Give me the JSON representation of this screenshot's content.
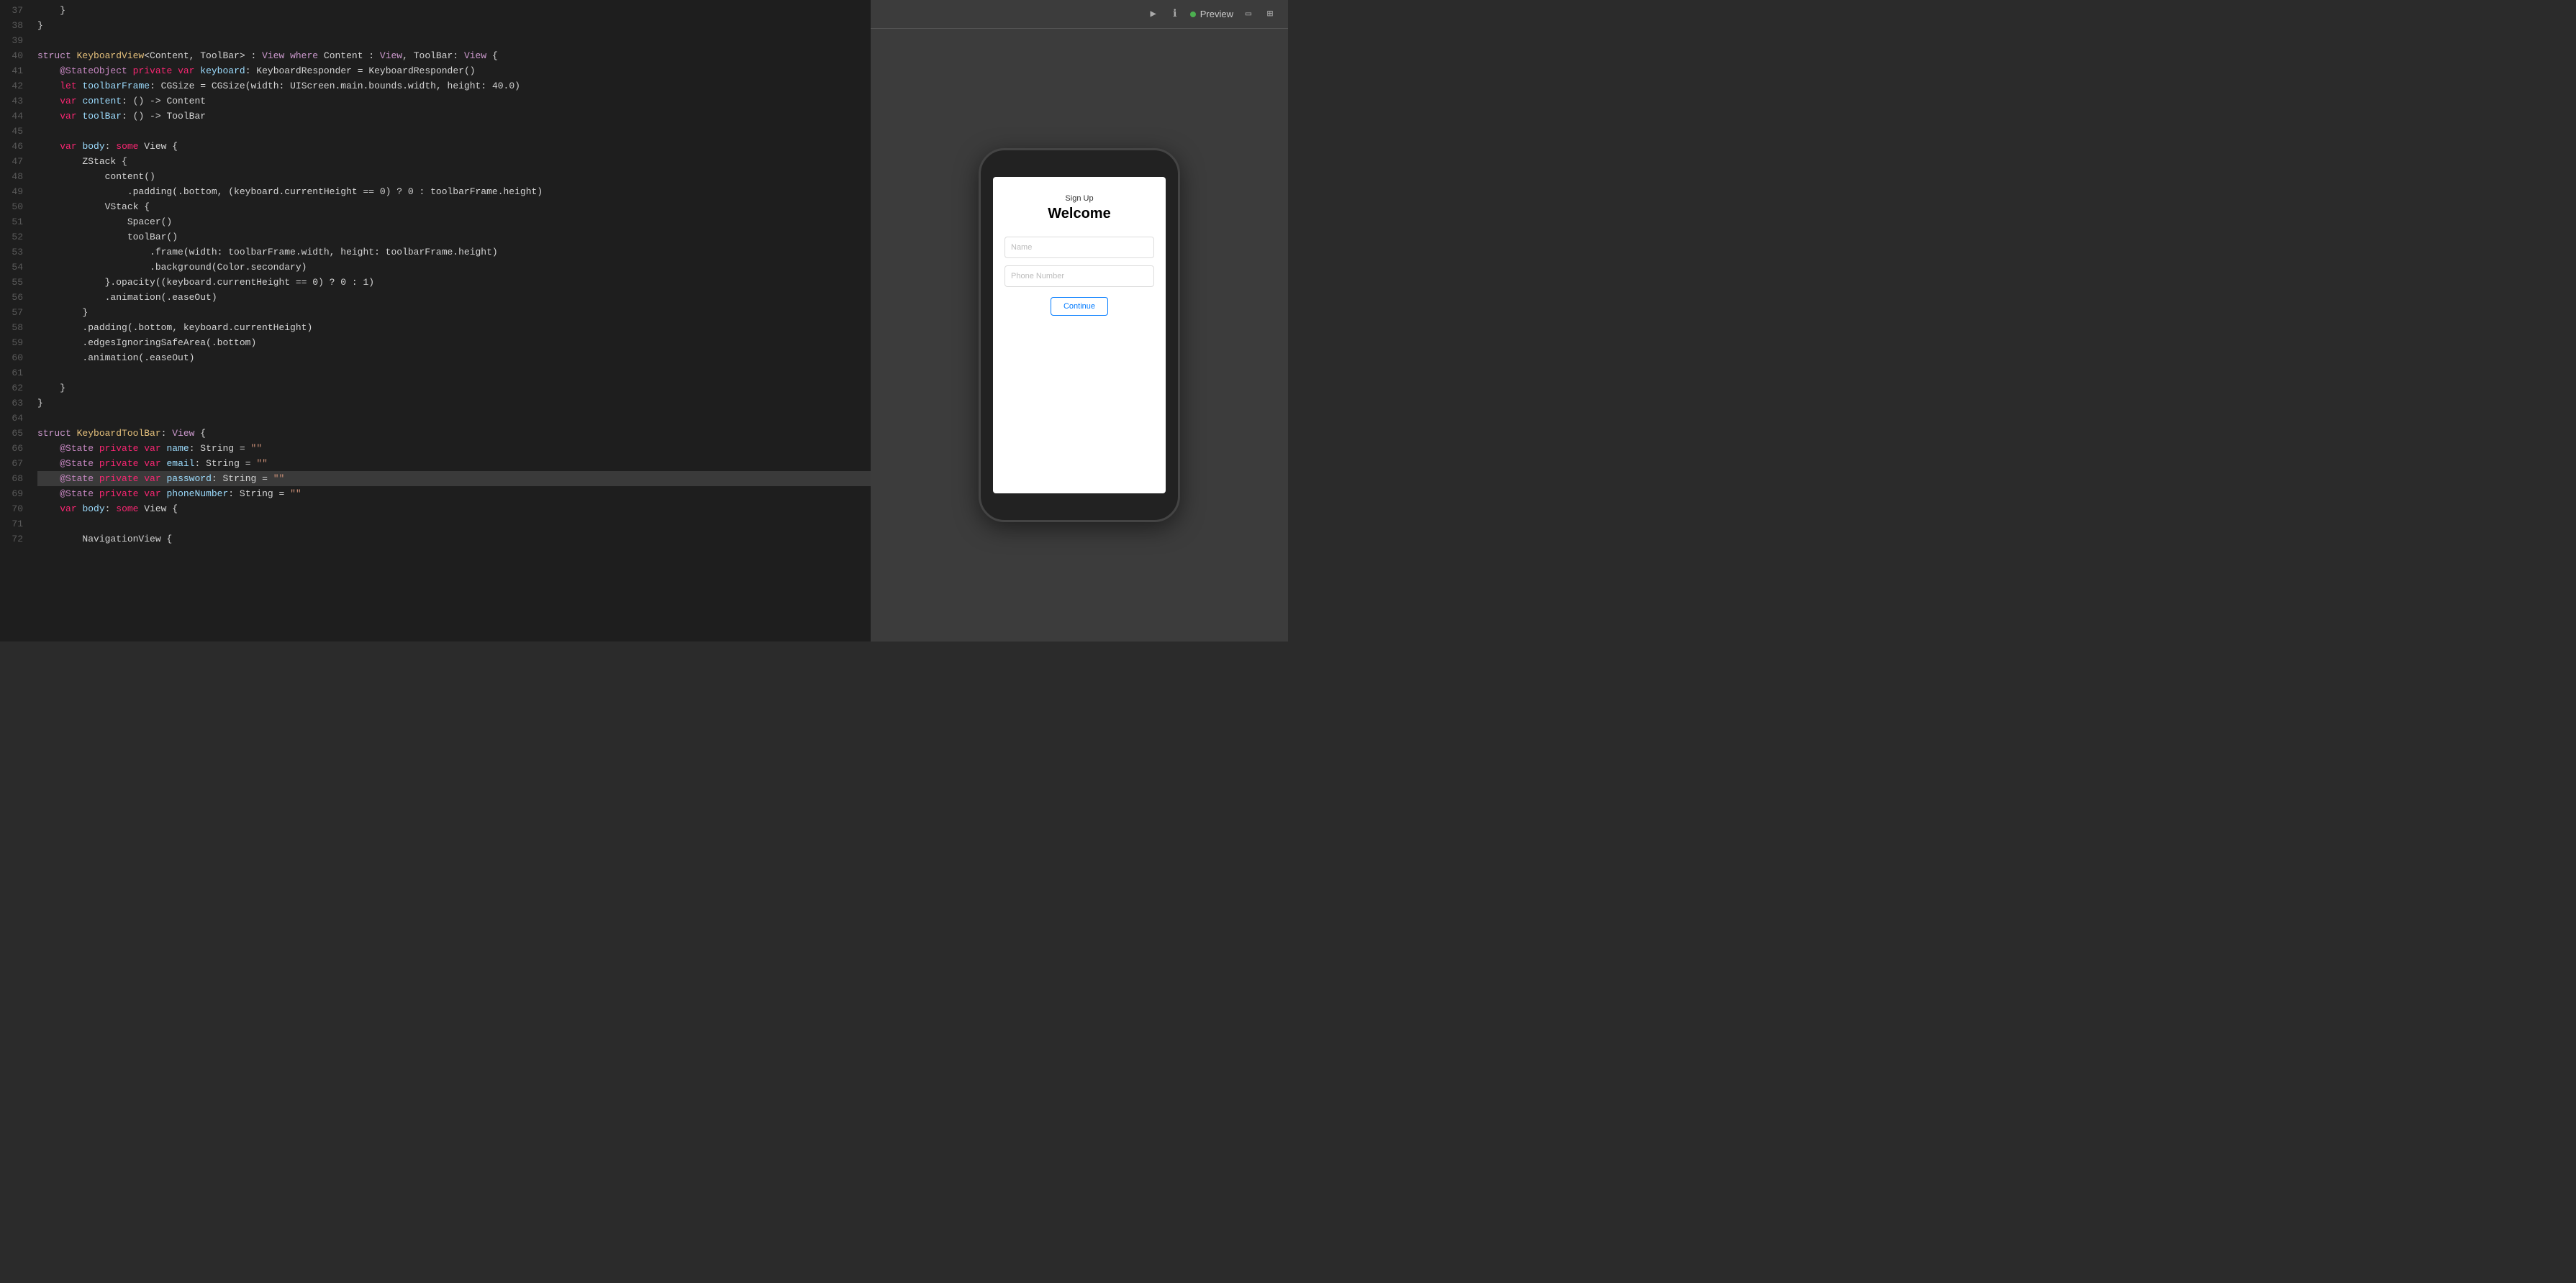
{
  "editor": {
    "lines": [
      {
        "num": 37,
        "content": [
          {
            "text": "    }",
            "class": "plain"
          }
        ],
        "highlighted": false
      },
      {
        "num": 38,
        "content": [
          {
            "text": "}",
            "class": "plain"
          }
        ],
        "highlighted": false
      },
      {
        "num": 39,
        "content": [],
        "highlighted": false
      },
      {
        "num": 40,
        "content": [
          {
            "text": "struct ",
            "class": "kw-struct"
          },
          {
            "text": "KeyboardView",
            "class": "type-name"
          },
          {
            "text": "<Content, ToolBar> : ",
            "class": "plain"
          },
          {
            "text": "View ",
            "class": "kw-view"
          },
          {
            "text": "where ",
            "class": "kw-where"
          },
          {
            "text": "Content : ",
            "class": "plain"
          },
          {
            "text": "View",
            "class": "kw-view"
          },
          {
            "text": ", ToolBar: ",
            "class": "plain"
          },
          {
            "text": "View",
            "class": "kw-view"
          },
          {
            "text": " {",
            "class": "plain"
          }
        ],
        "highlighted": false
      },
      {
        "num": 41,
        "content": [
          {
            "text": "    ",
            "class": "plain"
          },
          {
            "text": "@StateObject ",
            "class": "state-decorator"
          },
          {
            "text": "private ",
            "class": "pink-kw"
          },
          {
            "text": "var ",
            "class": "pink-kw"
          },
          {
            "text": "keyboard",
            "class": "blue-prop"
          },
          {
            "text": ": KeyboardResponder = KeyboardResponder()",
            "class": "plain"
          }
        ],
        "highlighted": false
      },
      {
        "num": 42,
        "content": [
          {
            "text": "    ",
            "class": "plain"
          },
          {
            "text": "let ",
            "class": "pink-kw"
          },
          {
            "text": "toolbarFrame",
            "class": "blue-prop"
          },
          {
            "text": ": CGSize = CGSize(width: UIScreen.main.bounds.width, height: 40.0)",
            "class": "plain"
          }
        ],
        "highlighted": false
      },
      {
        "num": 43,
        "content": [
          {
            "text": "    ",
            "class": "plain"
          },
          {
            "text": "var ",
            "class": "pink-kw"
          },
          {
            "text": "content",
            "class": "blue-prop"
          },
          {
            "text": ": () -> Content",
            "class": "plain"
          }
        ],
        "highlighted": false
      },
      {
        "num": 44,
        "content": [
          {
            "text": "    ",
            "class": "plain"
          },
          {
            "text": "var ",
            "class": "pink-kw"
          },
          {
            "text": "toolBar",
            "class": "blue-prop"
          },
          {
            "text": ": () -> ToolBar",
            "class": "plain"
          }
        ],
        "highlighted": false
      },
      {
        "num": 45,
        "content": [],
        "highlighted": false
      },
      {
        "num": 46,
        "content": [
          {
            "text": "    ",
            "class": "plain"
          },
          {
            "text": "var ",
            "class": "pink-kw"
          },
          {
            "text": "body",
            "class": "blue-prop"
          },
          {
            "text": ": ",
            "class": "plain"
          },
          {
            "text": "some ",
            "class": "pink-kw"
          },
          {
            "text": "View",
            "class": "plain"
          },
          {
            "text": " {",
            "class": "plain"
          }
        ],
        "highlighted": false
      },
      {
        "num": 47,
        "content": [
          {
            "text": "        ZStack {",
            "class": "plain"
          }
        ],
        "highlighted": false
      },
      {
        "num": 48,
        "content": [
          {
            "text": "            content()",
            "class": "plain"
          }
        ],
        "highlighted": false
      },
      {
        "num": 49,
        "content": [
          {
            "text": "                .padding(.bottom, (keyboard.currentHeight == 0) ? 0 : toolbarFrame.height)",
            "class": "plain"
          }
        ],
        "highlighted": false
      },
      {
        "num": 50,
        "content": [
          {
            "text": "            VStack {",
            "class": "plain"
          }
        ],
        "highlighted": false
      },
      {
        "num": 51,
        "content": [
          {
            "text": "                Spacer()",
            "class": "plain"
          }
        ],
        "highlighted": false
      },
      {
        "num": 52,
        "content": [
          {
            "text": "                toolBar()",
            "class": "plain"
          }
        ],
        "highlighted": false
      },
      {
        "num": 53,
        "content": [
          {
            "text": "                    .frame(width: toolbarFrame.width, height: toolbarFrame.height)",
            "class": "plain"
          }
        ],
        "highlighted": false
      },
      {
        "num": 54,
        "content": [
          {
            "text": "                    .background(Color.secondary)",
            "class": "plain"
          }
        ],
        "highlighted": false
      },
      {
        "num": 55,
        "content": [
          {
            "text": "            }.opacity((keyboard.currentHeight == 0) ? 0 : 1)",
            "class": "plain"
          }
        ],
        "highlighted": false
      },
      {
        "num": 56,
        "content": [
          {
            "text": "            .animation(.easeOut)",
            "class": "plain"
          }
        ],
        "highlighted": false
      },
      {
        "num": 57,
        "content": [
          {
            "text": "        }",
            "class": "plain"
          }
        ],
        "highlighted": false
      },
      {
        "num": 58,
        "content": [
          {
            "text": "        .padding(.bottom, keyboard.currentHeight)",
            "class": "plain"
          }
        ],
        "highlighted": false
      },
      {
        "num": 59,
        "content": [
          {
            "text": "        .edgesIgnoringSafeArea(.bottom)",
            "class": "plain"
          }
        ],
        "highlighted": false
      },
      {
        "num": 60,
        "content": [
          {
            "text": "        .animation(.easeOut)",
            "class": "plain"
          }
        ],
        "highlighted": false
      },
      {
        "num": 61,
        "content": [],
        "highlighted": false
      },
      {
        "num": 62,
        "content": [
          {
            "text": "    }",
            "class": "plain"
          }
        ],
        "highlighted": false
      },
      {
        "num": 63,
        "content": [
          {
            "text": "}",
            "class": "plain"
          }
        ],
        "highlighted": false
      },
      {
        "num": 64,
        "content": [],
        "highlighted": false
      },
      {
        "num": 65,
        "content": [
          {
            "text": "struct ",
            "class": "kw-struct"
          },
          {
            "text": "KeyboardToolBar",
            "class": "type-name"
          },
          {
            "text": ": ",
            "class": "plain"
          },
          {
            "text": "View",
            "class": "kw-view"
          },
          {
            "text": " {",
            "class": "plain"
          }
        ],
        "highlighted": false
      },
      {
        "num": 66,
        "content": [
          {
            "text": "    ",
            "class": "plain"
          },
          {
            "text": "@State ",
            "class": "state-decorator"
          },
          {
            "text": "private ",
            "class": "pink-kw"
          },
          {
            "text": "var ",
            "class": "pink-kw"
          },
          {
            "text": "name",
            "class": "blue-prop"
          },
          {
            "text": ": String = ",
            "class": "plain"
          },
          {
            "text": "\"\"",
            "class": "string-val"
          }
        ],
        "highlighted": false
      },
      {
        "num": 67,
        "content": [
          {
            "text": "    ",
            "class": "plain"
          },
          {
            "text": "@State ",
            "class": "state-decorator"
          },
          {
            "text": "private ",
            "class": "pink-kw"
          },
          {
            "text": "var ",
            "class": "pink-kw"
          },
          {
            "text": "email",
            "class": "blue-prop"
          },
          {
            "text": ": String = ",
            "class": "plain"
          },
          {
            "text": "\"\"",
            "class": "string-val"
          }
        ],
        "highlighted": false
      },
      {
        "num": 68,
        "content": [
          {
            "text": "    ",
            "class": "plain"
          },
          {
            "text": "@State ",
            "class": "state-decorator"
          },
          {
            "text": "private ",
            "class": "pink-kw"
          },
          {
            "text": "var ",
            "class": "pink-kw"
          },
          {
            "text": "password",
            "class": "blue-prop"
          },
          {
            "text": ": String = ",
            "class": "plain"
          },
          {
            "text": "\"\"",
            "class": "string-val"
          }
        ],
        "highlighted": true
      },
      {
        "num": 69,
        "content": [
          {
            "text": "    ",
            "class": "plain"
          },
          {
            "text": "@State ",
            "class": "state-decorator"
          },
          {
            "text": "private ",
            "class": "pink-kw"
          },
          {
            "text": "var ",
            "class": "pink-kw"
          },
          {
            "text": "phoneNumber",
            "class": "blue-prop"
          },
          {
            "text": ": String = ",
            "class": "plain"
          },
          {
            "text": "\"\"",
            "class": "string-val"
          }
        ],
        "highlighted": false
      },
      {
        "num": 70,
        "content": [
          {
            "text": "    ",
            "class": "plain"
          },
          {
            "text": "var ",
            "class": "pink-kw"
          },
          {
            "text": "body",
            "class": "blue-prop"
          },
          {
            "text": ": ",
            "class": "plain"
          },
          {
            "text": "some ",
            "class": "pink-kw"
          },
          {
            "text": "View",
            "class": "plain"
          },
          {
            "text": " {",
            "class": "plain"
          }
        ],
        "highlighted": false
      },
      {
        "num": 71,
        "content": [],
        "highlighted": false
      },
      {
        "num": 72,
        "content": [
          {
            "text": "        NavigationView {",
            "class": "plain"
          }
        ],
        "highlighted": false
      }
    ]
  },
  "preview": {
    "toolbar": {
      "play_icon": "▶",
      "inspect_icon": "ℹ",
      "preview_label": "Preview",
      "device_icon": "▭",
      "pin_icon": "⊞"
    },
    "phone": {
      "sign_up": "Sign Up",
      "welcome": "Welcome",
      "name_placeholder": "Name",
      "phone_placeholder": "Phone Number",
      "button_label": "Continue"
    }
  }
}
